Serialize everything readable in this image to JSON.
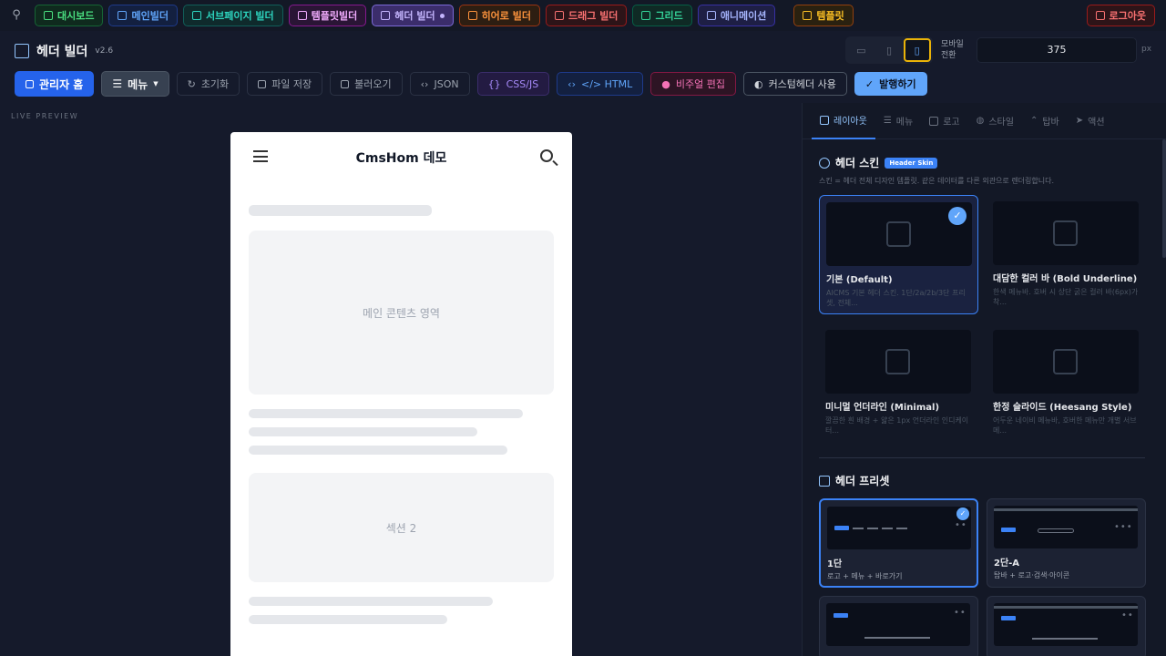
{
  "topnav": {
    "items": [
      {
        "label": "대시보드"
      },
      {
        "label": "메인빌더"
      },
      {
        "label": "서브페이지 빌더"
      },
      {
        "label": "템플릿빌더"
      },
      {
        "label": "헤더 빌더"
      },
      {
        "label": "히어로 빌더"
      },
      {
        "label": "드래그 빌더"
      },
      {
        "label": "그리드"
      },
      {
        "label": "애니메이션"
      },
      {
        "label": "템플릿"
      }
    ],
    "logout": "로그아웃"
  },
  "header": {
    "title": "헤더 빌더",
    "version": "v2.6",
    "mobile_label": "모바일 전환",
    "width_value": "375",
    "unit": "px"
  },
  "toolbar": {
    "home": "관리자 홈",
    "menu": "메뉴",
    "reset": "초기화",
    "save": "파일 저장",
    "load": "불러오기",
    "json": "JSON",
    "cssjs": "CSS/JS",
    "html": "</> HTML",
    "visual": "비주얼 편집",
    "custom": "커스텀헤더 사용",
    "publish": "발행하기"
  },
  "preview": {
    "label": "LIVE PREVIEW",
    "site_title": "CmsHom 데모",
    "main_area": "메인 콘텐츠 영역",
    "section2": "섹션 2"
  },
  "panel": {
    "tabs": [
      {
        "label": "레이아웃"
      },
      {
        "label": "메뉴"
      },
      {
        "label": "로고"
      },
      {
        "label": "스타일"
      },
      {
        "label": "탑바"
      },
      {
        "label": "액션"
      }
    ],
    "skin_title": "헤더 스킨",
    "skin_badge": "Header Skin",
    "skin_desc": "스킨 = 헤더 전체 디자인 템플릿. 같은 데이터를 다른 외관으로 렌더링합니다.",
    "skins": [
      {
        "name": "기본 (Default)",
        "desc": "AICMS 기본 헤더 스킨. 1단/2a/2b/3단 프리셋, 전체..."
      },
      {
        "name": "대담한 컬러 바 (Bold Underline)",
        "desc": "한색 메뉴바. 호버 시 상단 굵은 컬러 바(6px)가 착..."
      },
      {
        "name": "미니멀 언더라인 (Minimal)",
        "desc": "깔끔한 흰 배경 + 얇은 1px 언더라인 인디케이터..."
      },
      {
        "name": "한정 슬라이드 (Heesang Style)",
        "desc": "어두운 네이비 메뉴바, 호버한 메뉴만 개별 서브메..."
      }
    ],
    "preset_title": "헤더 프리셋",
    "presets": [
      {
        "name": "1단",
        "desc": "로고 + 메뉴 + 바로가기"
      },
      {
        "name": "2단-A",
        "desc": "탑바 + 로고·검색·아이콘"
      }
    ]
  }
}
